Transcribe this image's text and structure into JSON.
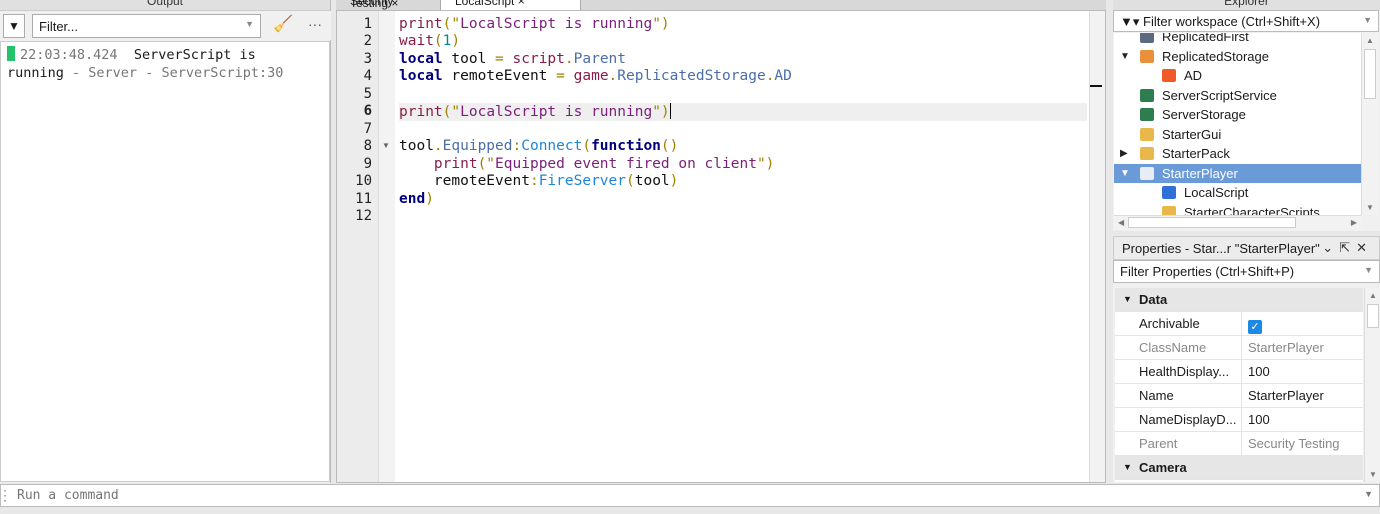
{
  "output": {
    "title": "Output",
    "filter_placeholder": "Filter...",
    "messages": [
      {
        "time": "22:03:48.424",
        "text": "ServerScript is",
        "text2": "running",
        "source": " -  Server - ServerScript:30"
      }
    ]
  },
  "editor": {
    "tabs": [
      {
        "label": "Security Testing ×"
      },
      {
        "label": "LocalScript ×"
      }
    ],
    "current_line": 6,
    "lines": [
      [
        [
          "print",
          "print"
        ],
        [
          "p",
          "(\""
        ],
        [
          "str",
          "LocalScript is running"
        ],
        [
          "p",
          "\")"
        ]
      ],
      [
        [
          "print",
          "wait"
        ],
        [
          "p",
          "("
        ],
        [
          "num",
          "1"
        ],
        [
          "p",
          ")"
        ]
      ],
      [
        [
          "kw",
          "local"
        ],
        [
          "id",
          " tool "
        ],
        [
          "op",
          "="
        ],
        [
          "id",
          " "
        ],
        [
          "print",
          "script"
        ],
        [
          "p",
          "."
        ],
        [
          "mem",
          "Parent"
        ]
      ],
      [
        [
          "kw",
          "local"
        ],
        [
          "id",
          " remoteEvent "
        ],
        [
          "op",
          "="
        ],
        [
          "id",
          " "
        ],
        [
          "print",
          "game"
        ],
        [
          "p",
          "."
        ],
        [
          "mem",
          "ReplicatedStorage"
        ],
        [
          "p",
          "."
        ],
        [
          "mem",
          "AD"
        ]
      ],
      [],
      [
        [
          "print",
          "print"
        ],
        [
          "p",
          "(\""
        ],
        [
          "str",
          "LocalScript is running"
        ],
        [
          "p",
          "\")"
        ]
      ],
      [],
      [
        [
          "id",
          "tool"
        ],
        [
          "p",
          "."
        ],
        [
          "mem",
          "Equipped"
        ],
        [
          "p",
          ":"
        ],
        [
          "meth",
          "Connect"
        ],
        [
          "p",
          "("
        ],
        [
          "kw",
          "function"
        ],
        [
          "p",
          "()"
        ]
      ],
      [
        [
          "id",
          "    "
        ],
        [
          "print",
          "print"
        ],
        [
          "p",
          "(\""
        ],
        [
          "str",
          "Equipped event fired on client"
        ],
        [
          "p",
          "\")"
        ]
      ],
      [
        [
          "id",
          "    remoteEvent"
        ],
        [
          "p",
          ":"
        ],
        [
          "meth",
          "FireServer"
        ],
        [
          "p",
          "("
        ],
        [
          "id",
          "tool"
        ],
        [
          "p",
          ")"
        ]
      ],
      [
        [
          "kw",
          "end"
        ],
        [
          "p",
          ")"
        ]
      ],
      []
    ]
  },
  "explorer": {
    "title": "Explorer",
    "filter_placeholder": "Filter workspace (Ctrl+Shift+X)",
    "items": [
      {
        "label": "ReplicatedFirst",
        "icon": "replicated-first-icon",
        "depth": 0,
        "arrow": "",
        "color": "#5a6a80"
      },
      {
        "label": "ReplicatedStorage",
        "icon": "replicated-storage-icon",
        "depth": 0,
        "arrow": "▼",
        "color": "#e8913a"
      },
      {
        "label": "AD",
        "icon": "remote-event-icon",
        "depth": 1,
        "arrow": "",
        "color": "#f05a28"
      },
      {
        "label": "ServerScriptService",
        "icon": "server-script-service-icon",
        "depth": 0,
        "arrow": "",
        "color": "#2e7d4f"
      },
      {
        "label": "ServerStorage",
        "icon": "server-storage-icon",
        "depth": 0,
        "arrow": "",
        "color": "#2e7d4f"
      },
      {
        "label": "StarterGui",
        "icon": "starter-gui-icon",
        "depth": 0,
        "arrow": "",
        "color": "#e8b84a"
      },
      {
        "label": "StarterPack",
        "icon": "starter-pack-icon",
        "depth": 0,
        "arrow": "▶",
        "color": "#e8b84a"
      },
      {
        "label": "StarterPlayer",
        "icon": "starter-player-icon",
        "depth": 0,
        "arrow": "▼",
        "color": "#e8ecf5",
        "selected": true
      },
      {
        "label": "LocalScript",
        "icon": "local-script-icon",
        "depth": 1,
        "arrow": "",
        "color": "#2f6fd6"
      },
      {
        "label": "StarterCharacterScripts",
        "icon": "folder-icon",
        "depth": 1,
        "arrow": "",
        "color": "#e8b84a"
      }
    ]
  },
  "properties": {
    "title": "Properties - Star...r \"StarterPlayer\"",
    "filter_placeholder": "Filter Properties (Ctrl+Shift+P)",
    "rows": [
      {
        "category": "Data"
      },
      {
        "name": "Archivable",
        "checked": true
      },
      {
        "name": "ClassName",
        "value": "StarterPlayer",
        "readonly": true
      },
      {
        "name": "HealthDisplay...",
        "value": "100"
      },
      {
        "name": "Name",
        "value": "StarterPlayer"
      },
      {
        "name": "NameDisplayD...",
        "value": "100"
      },
      {
        "name": "Parent",
        "value": "Security Testing",
        "readonly": true
      },
      {
        "category": "Camera"
      }
    ]
  },
  "command": {
    "placeholder": "Run a command"
  }
}
